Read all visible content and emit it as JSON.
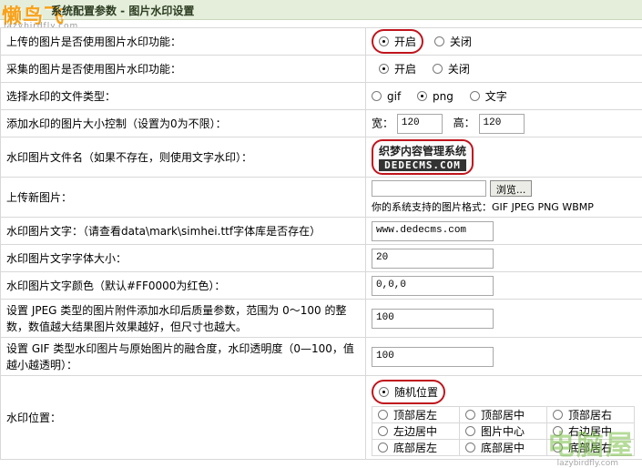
{
  "header": {
    "logo": "懒鸟飞",
    "logo_sub": "lazybirdfly.com",
    "title": "系统配置参数 - 图片水印设置"
  },
  "rows": {
    "upload_wm": {
      "label": "上传的图片是否使用图片水印功能：",
      "opt_on": "开启",
      "opt_off": "关闭",
      "selected": "开启"
    },
    "collect_wm": {
      "label": "采集的图片是否使用图片水印功能：",
      "opt_on": "开启",
      "opt_off": "关闭",
      "selected": "开启"
    },
    "wm_type": {
      "label": "选择水印的文件类型：",
      "opt_gif": "gif",
      "opt_png": "png",
      "opt_text": "文字",
      "selected": "png"
    },
    "wm_size": {
      "label": "添加水印的图片大小控制（设置为0为不限）：",
      "width_label": "宽：",
      "width_value": "120",
      "height_label": "高：",
      "height_value": "120"
    },
    "wm_file": {
      "label": "水印图片文件名（如果不存在，则使用文字水印）：",
      "preview_line1": "织梦内容管理系统",
      "preview_line2": "DEDECMS.COM"
    },
    "upload_new": {
      "label": "上传新图片：",
      "browse": "浏览...",
      "formats": "你的系统支持的图片格式：GIF JPEG PNG WBMP"
    },
    "wm_text": {
      "label": "水印图片文字：（请查看data\\mark\\simhei.ttf字体库是否存在）",
      "value": "www.dedecms.com"
    },
    "wm_font_size": {
      "label": "水印图片文字字体大小：",
      "value": "20"
    },
    "wm_font_color": {
      "label": "水印图片文字颜色（默认#FF0000为红色）：",
      "value": "0,0,0"
    },
    "jpeg_quality": {
      "label": "设置 JPEG 类型的图片附件添加水印后质量参数，范围为 0～100 的整数，数值越大结果图片效果越好，但尺寸也越大。",
      "value": "100"
    },
    "gif_opacity": {
      "label": "设置 GIF 类型水印图片与原始图片的融合度，水印透明度（0—100，值越小越透明）：",
      "value": "100"
    },
    "wm_position": {
      "label": "水印位置：",
      "random": "随机位置",
      "selected": "随机位置",
      "grid": [
        [
          "顶部居左",
          "顶部居中",
          "顶部居右"
        ],
        [
          "左边居中",
          "图片中心",
          "右边居中"
        ],
        [
          "底部居左",
          "底部居中",
          "底部居右"
        ]
      ]
    }
  },
  "overlay": {
    "watermark": "电脑屋",
    "watermark_sub": "lazybirdfly.com"
  },
  "colors": {
    "header_bg": "#e4eedb",
    "annotation_red": "#c0141c",
    "logo_orange": "#f7a21a"
  }
}
